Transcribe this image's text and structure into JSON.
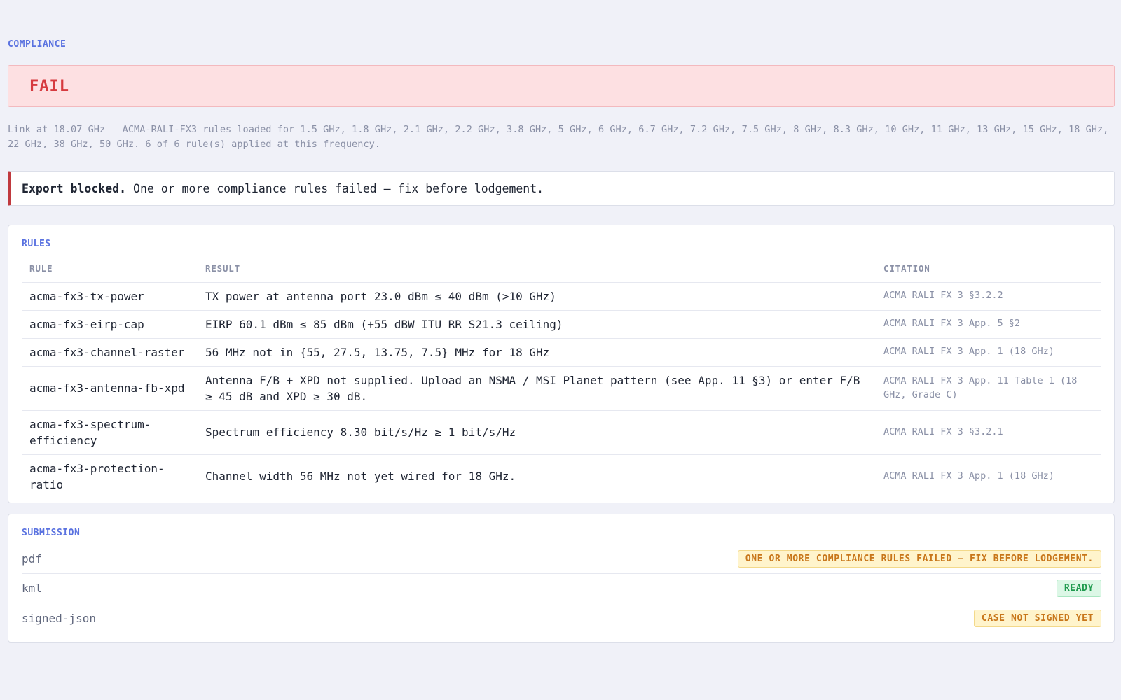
{
  "compliance": {
    "title": "COMPLIANCE",
    "status": "FAIL",
    "summary": "Link at 18.07 GHz — ACMA-RALI-FX3 rules loaded for 1.5 GHz, 1.8 GHz, 2.1 GHz, 2.2 GHz, 3.8 GHz, 5 GHz, 6 GHz, 6.7 GHz, 7.2 GHz, 7.5 GHz, 8 GHz, 8.3 GHz, 10 GHz, 11 GHz, 13 GHz, 15 GHz, 18 GHz, 22 GHz, 38 GHz, 50 GHz. 6 of 6 rule(s) applied at this frequency.",
    "status_color": "#d63a3f"
  },
  "export": {
    "strong": "Export blocked.",
    "message": "One or more compliance rules failed — fix before lodgement."
  },
  "rules": {
    "title": "RULES",
    "columns": [
      "RULE",
      "RESULT",
      "CITATION"
    ],
    "rows": [
      {
        "rule": "acma-fx3-tx-power",
        "result": "TX power at antenna port 23.0 dBm ≤ 40 dBm (>10 GHz)",
        "citation": "ACMA RALI FX 3 §3.2.2"
      },
      {
        "rule": "acma-fx3-eirp-cap",
        "result": "EIRP 60.1 dBm ≤ 85 dBm (+55 dBW ITU RR S21.3 ceiling)",
        "citation": "ACMA RALI FX 3 App. 5 §2"
      },
      {
        "rule": "acma-fx3-channel-raster",
        "result": "56 MHz not in {55, 27.5, 13.75, 7.5} MHz for 18 GHz",
        "citation": "ACMA RALI FX 3 App. 1 (18 GHz)"
      },
      {
        "rule": "acma-fx3-antenna-fb-xpd",
        "result": "Antenna F/B + XPD not supplied. Upload an NSMA / MSI Planet pattern (see App. 11 §3) or enter F/B ≥ 45 dB and XPD ≥ 30 dB.",
        "citation": "ACMA RALI FX 3 App. 11 Table 1 (18 GHz, Grade C)"
      },
      {
        "rule": "acma-fx3-spectrum-efficiency",
        "result": "Spectrum efficiency 8.30 bit/s/Hz ≥ 1 bit/s/Hz",
        "citation": "ACMA RALI FX 3 §3.2.1"
      },
      {
        "rule": "acma-fx3-protection-ratio",
        "result": "Channel width 56 MHz not yet wired for 18 GHz.",
        "citation": "ACMA RALI FX 3 App. 1 (18 GHz)"
      }
    ]
  },
  "submission": {
    "title": "SUBMISSION",
    "items": [
      {
        "name": "pdf",
        "status": "ONE OR MORE COMPLIANCE RULES FAILED — FIX BEFORE LODGEMENT.",
        "kind": "warn"
      },
      {
        "name": "kml",
        "status": "READY",
        "kind": "ok"
      },
      {
        "name": "signed-json",
        "status": "CASE NOT SIGNED YET",
        "kind": "warn"
      }
    ]
  }
}
